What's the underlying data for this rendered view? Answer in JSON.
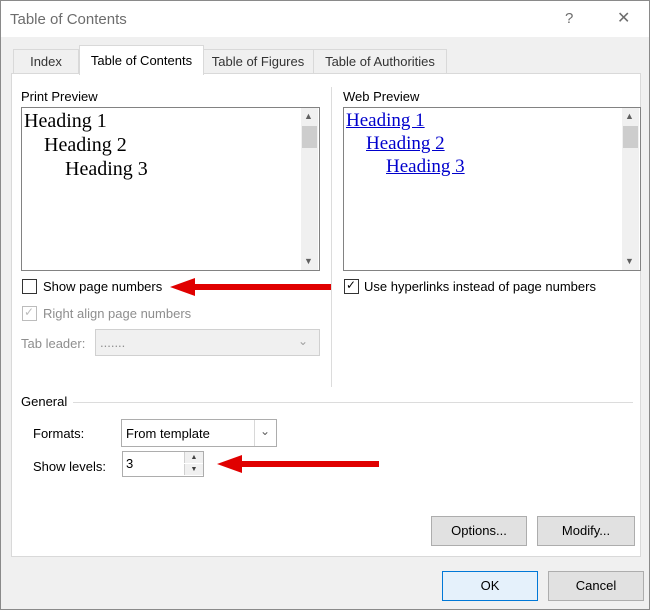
{
  "window": {
    "title": "Table of Contents",
    "help": "?",
    "close": "✕"
  },
  "tabs": [
    {
      "label": "Index"
    },
    {
      "label": "Table of Contents",
      "active": true
    },
    {
      "label": "Table of Figures"
    },
    {
      "label": "Table of Authorities"
    }
  ],
  "print_preview": {
    "label": "Print Preview",
    "headings": [
      "Heading 1",
      "Heading 2",
      "Heading 3"
    ]
  },
  "web_preview": {
    "label": "Web Preview",
    "headings": [
      "Heading 1",
      "Heading 2",
      "Heading 3"
    ],
    "link_color": "#0000cc"
  },
  "options": {
    "show_page_numbers": {
      "label": "Show page numbers",
      "checked": false
    },
    "right_align": {
      "label": "Right align page numbers",
      "checked": true,
      "disabled": true
    },
    "tab_leader": {
      "label": "Tab leader:",
      "value": "......."
    },
    "use_hyperlinks": {
      "label": "Use hyperlinks instead of page numbers",
      "checked": true
    }
  },
  "general": {
    "label": "General",
    "formats_label": "Formats:",
    "formats_value": "From template",
    "levels_label": "Show levels:",
    "levels_value": "3"
  },
  "buttons": {
    "options": "Options...",
    "modify": "Modify...",
    "ok": "OK",
    "cancel": "Cancel"
  },
  "annotation_color": "#e00000"
}
